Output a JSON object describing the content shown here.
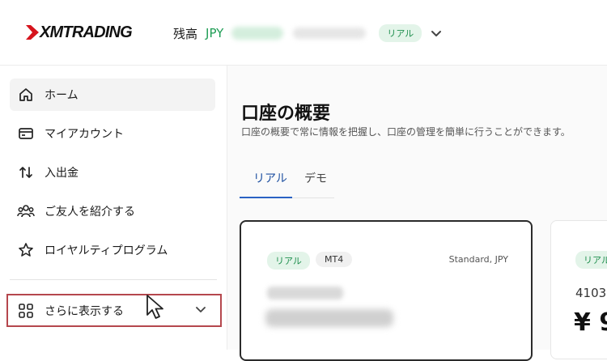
{
  "header": {
    "logo_text": "XMTRADING",
    "balance_label": "残高",
    "currency": "JPY",
    "badge": "リアル"
  },
  "sidebar": {
    "items": [
      {
        "label": "ホーム",
        "icon": "home-icon"
      },
      {
        "label": "マイアカウント",
        "icon": "card-icon"
      },
      {
        "label": "入出金",
        "icon": "transfer-arrows-icon"
      },
      {
        "label": "ご友人を紹介する",
        "icon": "people-icon"
      },
      {
        "label": "ロイヤルティプログラム",
        "icon": "star-icon"
      }
    ],
    "more_label": "さらに表示する"
  },
  "main": {
    "title": "口座の概要",
    "subtitle": "口座の概要で常に情報を把握し、口座の管理を簡単に行うことができます。",
    "tabs": [
      {
        "label": "リアル",
        "active": true
      },
      {
        "label": "デモ",
        "active": false
      }
    ],
    "cards": [
      {
        "badge": "リアル",
        "platform": "MT4",
        "type": "Standard, JPY"
      },
      {
        "badge": "リアル",
        "number": "4103",
        "amount": "¥ 9"
      }
    ]
  },
  "colors": {
    "accent_green": "#1f9d55",
    "tab_blue": "#2a62c4",
    "highlight_border": "#b5474d"
  }
}
